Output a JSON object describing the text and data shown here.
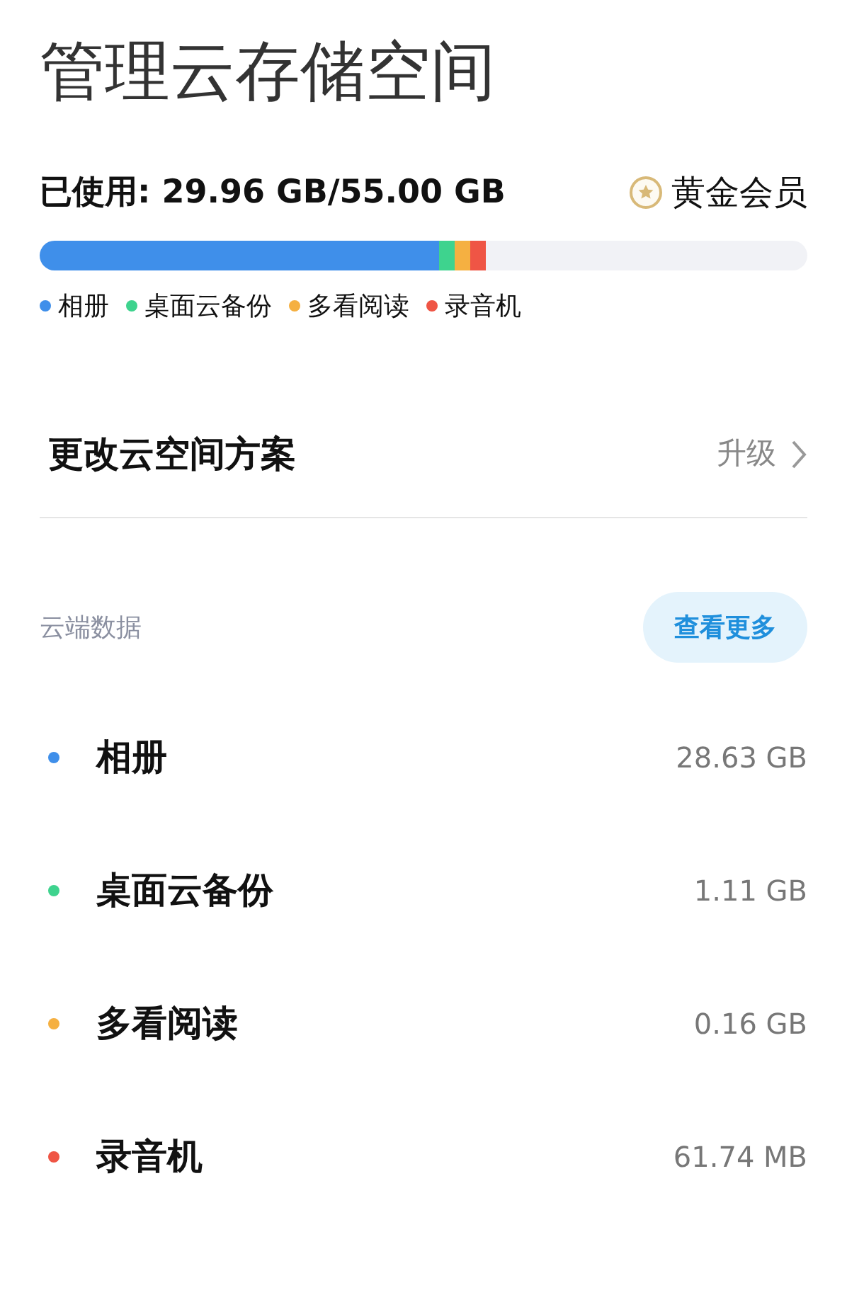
{
  "title": "管理云存储空间",
  "usage": {
    "text": "已使用: 29.96 GB/55.00 GB",
    "membership": "黄金会员"
  },
  "bar": [
    {
      "color": "#3f8fea",
      "level": 0.52
    },
    {
      "color": "#3ed38e"
    },
    {
      "color": "#f5b041"
    },
    {
      "color": "#ef5545"
    }
  ],
  "legend": [
    {
      "name": "相册",
      "color": "#3f8fea"
    },
    {
      "name": "桌面云备份",
      "color": "#3ed38e"
    },
    {
      "name": "多看阅读",
      "color": "#f5b041"
    },
    {
      "name": "录音机",
      "color": "#ef5545"
    }
  ],
  "plan": {
    "label": "更改云空间方案",
    "action": "升级"
  },
  "cloud_data": {
    "heading": "云端数据",
    "button": "查看更多",
    "items": [
      {
        "name": "相册",
        "size": "28.63 GB",
        "color": "#3f8fea"
      },
      {
        "name": "桌面云备份",
        "size": "1.11 GB",
        "color": "#3ed38e"
      },
      {
        "name": "多看阅读",
        "size": "0.16 GB",
        "color": "#f5b041"
      },
      {
        "name": "录音机",
        "size": "61.74 MB",
        "color": "#ef5545"
      }
    ]
  }
}
